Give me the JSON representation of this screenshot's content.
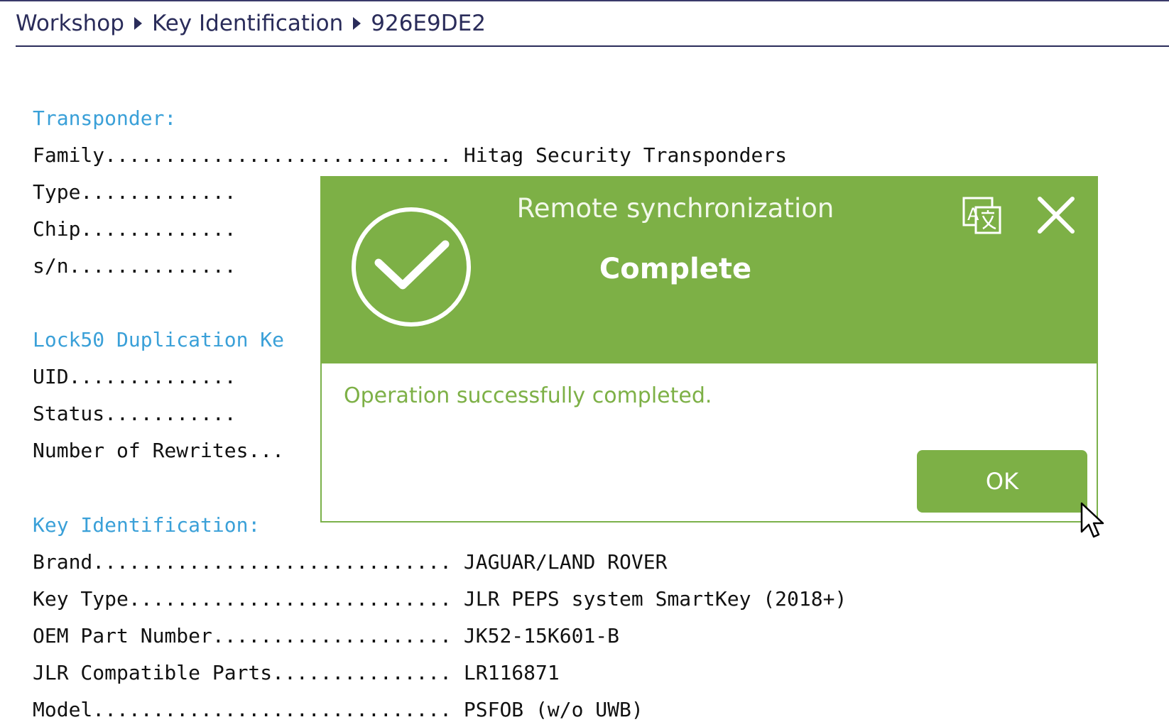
{
  "breadcrumb": {
    "items": [
      "Workshop",
      "Key Identification",
      "926E9DE2"
    ]
  },
  "report": {
    "sections": [
      {
        "title": "Transponder:",
        "rows": [
          {
            "label": "Family.............................",
            "value": " Hitag Security Transponders"
          },
          {
            "label": "Type.............",
            "value": ""
          },
          {
            "label": "Chip.............",
            "value": ""
          },
          {
            "label": "s/n..............",
            "value": ""
          }
        ]
      },
      {
        "title": "Lock50 Duplication Ke",
        "rows": [
          {
            "label": "UID..............",
            "value": ""
          },
          {
            "label": "Status...........",
            "value": ""
          },
          {
            "label": "Number of Rewrites...",
            "value": ""
          }
        ]
      },
      {
        "title": "Key Identification:",
        "rows": [
          {
            "label": "Brand..............................",
            "value": " JAGUAR/LAND ROVER"
          },
          {
            "label": "Key Type...........................",
            "value": " JLR PEPS system SmartKey (2018+)"
          },
          {
            "label": "OEM Part Number....................",
            "value": " JK52-15K601-B"
          },
          {
            "label": "JLR Compatible Parts...............",
            "value": " LR116871"
          },
          {
            "label": "Model..............................",
            "value": " PSFOB (w/o UWB)"
          }
        ]
      }
    ]
  },
  "dialog": {
    "title": "Remote synchronization",
    "status": "Complete",
    "message": "Operation successfully completed.",
    "ok_label": "OK",
    "translate_icon_text": "A"
  },
  "colors": {
    "accent_green": "#7db046",
    "section_blue": "#3aa0d8",
    "navy": "#2a2c5a"
  }
}
